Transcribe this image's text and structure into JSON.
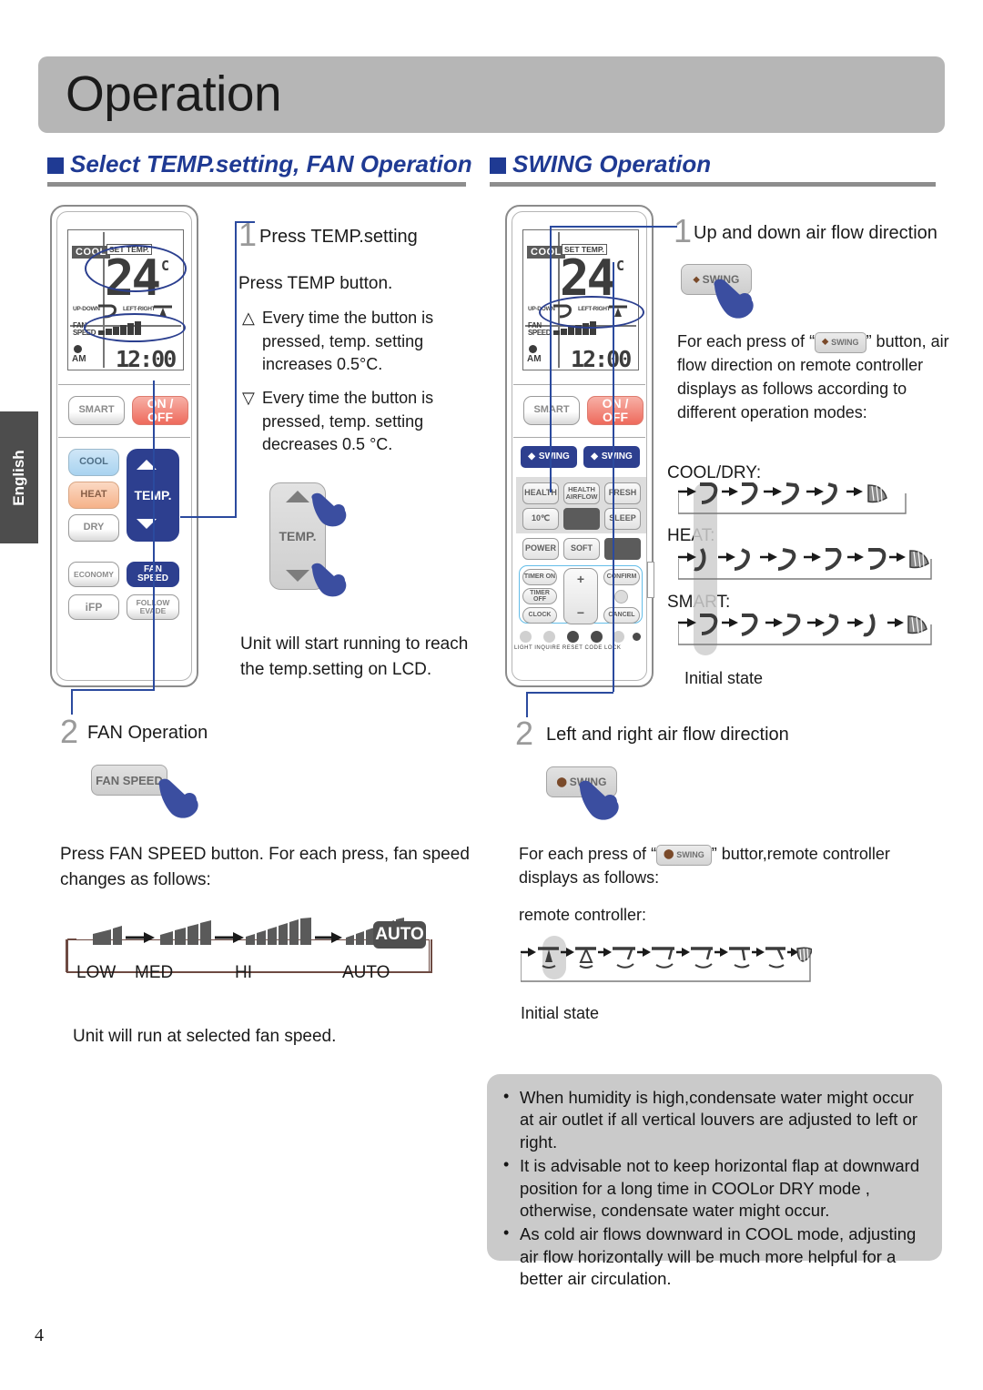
{
  "page": {
    "title": "Operation",
    "language_tab": "English",
    "page_number": "4"
  },
  "sections": {
    "left": {
      "heading": "Select TEMP.setting, FAN Operation"
    },
    "right": {
      "heading": "SWING Operation"
    }
  },
  "remote_lcd": {
    "mode": "COOL",
    "set_temp_label": "SET TEMP.",
    "temperature": "24",
    "degree_unit": "C",
    "updown_label": "UP-DOWN",
    "leftright_label": "LEFT-RIGHT",
    "fan_label_line1": "FAN",
    "fan_label_line2": "SPEED",
    "ampm": "AM",
    "clock": "12:00"
  },
  "remote_left_buttons": {
    "smart": "SMART",
    "on_off": "ON / OFF",
    "cool": "COOL",
    "heat": "HEAT",
    "dry": "DRY",
    "temp": "TEMP.",
    "economy": "ECONOMY",
    "fan_speed": "FAN SPEED",
    "ifp": "iFP",
    "follow": "FOLLOW",
    "evade": "EVADE"
  },
  "remote_right_buttons": {
    "smart": "SMART",
    "on_off": "ON / OFF",
    "swing_ud": "SWING",
    "swing_lr": "SWING",
    "health": "HEALTH",
    "health_airflow_l1": "HEALTH",
    "health_airflow_l2": "AIRFLOW",
    "fresh": "FRESH",
    "ten_deg": "10℃",
    "sleep": "SLEEP",
    "power": "POWER",
    "soft": "SOFT",
    "timer_on": "TIMER ON",
    "timer_off": "TIMER OFF",
    "clock": "CLOCK",
    "plus": "+",
    "minus": "−",
    "confirm": "CONFIRM",
    "cancel": "CANCEL",
    "dots": [
      "LIGHT",
      "INQUIRE",
      "RESET",
      "CODE",
      "LOCK"
    ]
  },
  "left_column": {
    "step1": {
      "number": "1",
      "title": "Press TEMP.setting",
      "lead": "Press TEMP button.",
      "up_marker": "△",
      "up_text": "Every time the button is pressed, temp. setting increases 0.5°C.",
      "down_marker": "▽",
      "down_text": "Every time the button is pressed, temp. setting decreases 0.5 °C.",
      "button_label": "TEMP.",
      "result": "Unit will start running to reach the temp.setting on LCD."
    },
    "step2": {
      "number": "2",
      "title": "FAN Operation",
      "button_label": "FAN SPEED",
      "body": "Press FAN SPEED button. For each press, fan  speed changes as follows:",
      "footer": "Unit will run at selected fan speed."
    }
  },
  "fan_sequence": {
    "labels": [
      "LOW",
      "MED",
      "HI",
      "AUTO"
    ],
    "bars": [
      2,
      4,
      6,
      7
    ],
    "auto_tag": "AUTO"
  },
  "right_column": {
    "step1": {
      "number": "1",
      "title": "Up and down air flow direction",
      "button_label": "SWING",
      "body_before": "For each press of “",
      "inline_button": "SWING",
      "body_after": "” button,",
      "body_rest": "air flow direction on remote controller displays as follows according to different operation modes:",
      "initial_state": "Initial state"
    },
    "step2": {
      "number": "2",
      "title": "Left and right air flow direction",
      "button_label": "SWING",
      "body_before": "For each press of “",
      "inline_button": "SWING",
      "body_after": "” buttor,remote controller",
      "body_rest": "displays as follows:",
      "body_rest2": "remote controller:",
      "initial_state": "Initial state"
    },
    "modes": [
      {
        "name": "COOL/DRY:",
        "steps": 5
      },
      {
        "name": "HEAT:",
        "steps": 6
      },
      {
        "name": "SMART:",
        "steps": 6
      }
    ],
    "lr_steps": 8
  },
  "notes": [
    "When humidity is high,condensate water might occur at air outlet if all vertical louvers are adjusted to left or right.",
    "It is advisable not to keep horizontal flap at downward position for a long time in COOLor DRY mode , otherwise, condensate water might occur.",
    "As cold air flows downward in COOL mode, adjusting air flow horizontally will be much more helpful for a better air circulation."
  ],
  "colors": {
    "accent_blue": "#1f3a93",
    "button_blue": "#2d3f8f",
    "header_grey": "#b6b6b6",
    "notes_grey": "#cacaca",
    "hand_blue": "#3b4ea0"
  }
}
